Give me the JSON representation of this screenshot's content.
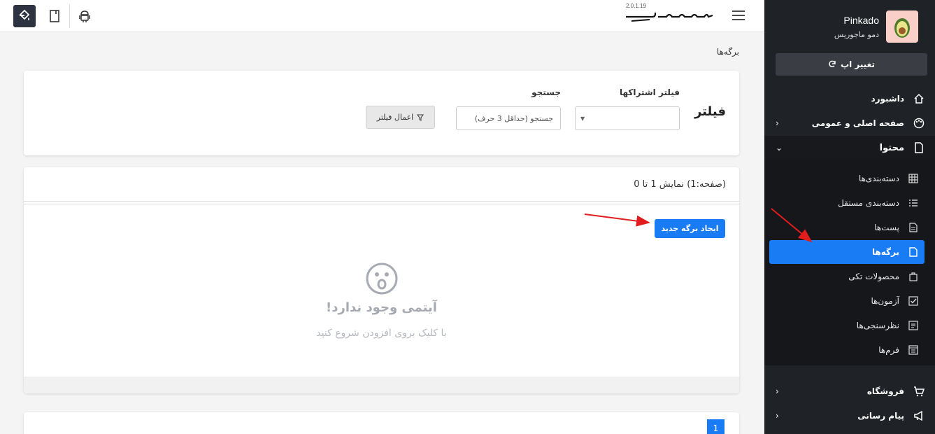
{
  "topbar": {
    "version": "2.0.1.19",
    "icons": [
      "paint-bucket-icon",
      "tablet-icon",
      "android-icon",
      "menu-icon"
    ]
  },
  "sidebar": {
    "app_name": "Pinkado",
    "app_subtitle": "دمو ماجوریس",
    "change_app_label": "تغییر اپ",
    "items": [
      {
        "label": "داشبورد",
        "icon": "home-icon"
      },
      {
        "label": "صفحه اصلی و عمومی",
        "icon": "palette-icon"
      },
      {
        "label": "محتوا",
        "icon": "file-icon"
      },
      {
        "label": "فروشگاه",
        "icon": "cart-icon"
      },
      {
        "label": "پیام رسانی",
        "icon": "megaphone-icon"
      }
    ],
    "content_items": [
      {
        "label": "دسته‌بندی‌ها",
        "icon": "grid-icon"
      },
      {
        "label": "دسته‌بندی مستقل",
        "icon": "list-icon"
      },
      {
        "label": "پست‌ها",
        "icon": "document-icon"
      },
      {
        "label": "برگه‌ها",
        "icon": "page-icon"
      },
      {
        "label": "محصولات تکی",
        "icon": "bag-icon"
      },
      {
        "label": "آزمون‌ها",
        "icon": "checkbox-icon"
      },
      {
        "label": "نظرسنجی‌ها",
        "icon": "poll-icon"
      },
      {
        "label": "فرم‌ها",
        "icon": "form-icon"
      }
    ]
  },
  "main": {
    "breadcrumb": "برگه‌ها",
    "filter": {
      "title": "فیلتر",
      "subscription_label": "فیلتر اشتراکها",
      "search_label": "جستجو",
      "search_placeholder": "جستجو (حداقل 3 حرف)",
      "apply_label": "اعمال فیلتر"
    },
    "list": {
      "paging_info": "(صفحه:1) نمایش 1 تا 0",
      "new_button": "ایجاد برگه جدید",
      "empty_title": "آیتمی وجود ندارد!",
      "empty_subtitle": "با کلیک بروی افزودن شروع کنید"
    },
    "pagination": {
      "current_page": "1"
    }
  },
  "colors": {
    "accent": "#1a7cf5",
    "sidebar_bg": "#1f2226",
    "annotation_arrow": "#e11d1d"
  }
}
